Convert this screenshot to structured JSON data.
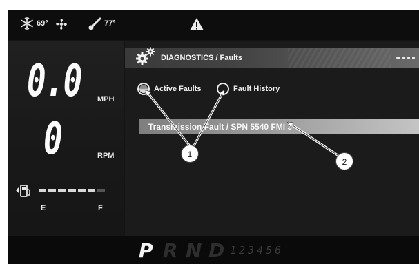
{
  "status_bar": {
    "outside_temp": "69°",
    "cab_temp": "77°",
    "icons": [
      "snowflake-icon",
      "fan-icon",
      "thermometer-icon",
      "warning-triangle-icon"
    ]
  },
  "gauges": {
    "speed_value": "0.0",
    "speed_unit": "MPH",
    "rpm_value": "0",
    "rpm_unit": "RPM",
    "fuel_empty_label": "E",
    "fuel_full_label": "F",
    "fuel_level": 0.85
  },
  "panel": {
    "header_title": "DIAGNOSTICS / Faults",
    "pager_dots": 4,
    "options": [
      {
        "label": "Active Faults",
        "selected": true
      },
      {
        "label": "Fault History",
        "selected": false
      }
    ],
    "fault_row": "Transmission Fault / SPN 5540 FMI 3"
  },
  "gear_bar": {
    "gears": [
      "P",
      "R",
      "N",
      "D"
    ],
    "active_gear": "P",
    "numbers": "123456"
  },
  "callouts": [
    "1",
    "2"
  ]
}
